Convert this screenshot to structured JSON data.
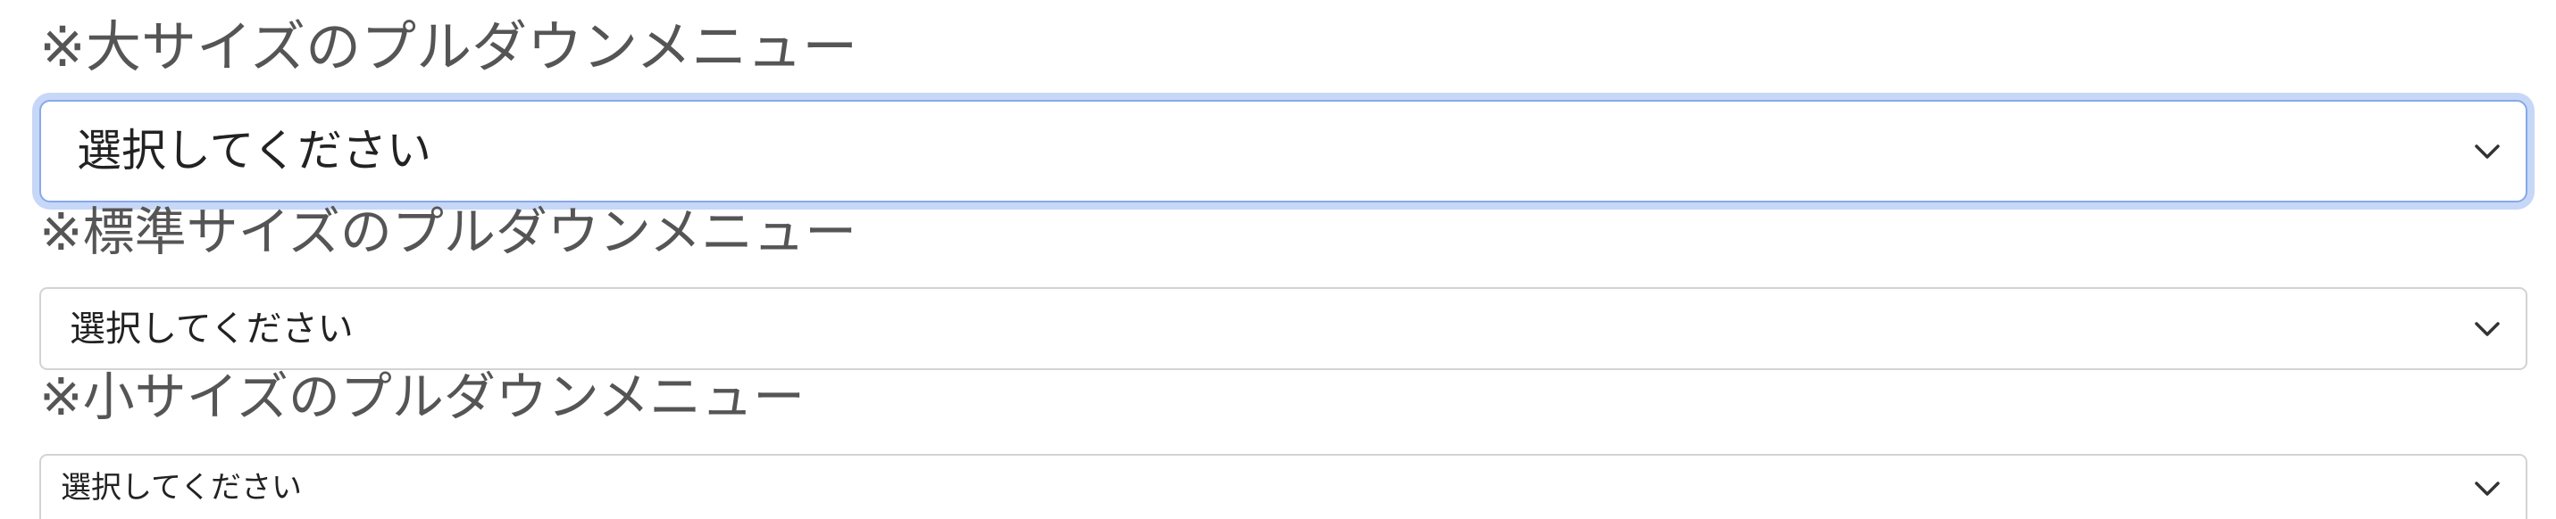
{
  "sections": [
    {
      "heading": "※大サイズのプルダウンメニュー",
      "select_value": "選択してください",
      "size": "large",
      "focused": true
    },
    {
      "heading": "※標準サイズのプルダウンメニュー",
      "select_value": "選択してください",
      "size": "normal",
      "focused": false
    },
    {
      "heading": "※小サイズのプルダウンメニュー",
      "select_value": "選択してください",
      "size": "small",
      "focused": false
    }
  ],
  "icons": {
    "dropdown": "chevron-down-icon"
  },
  "colors": {
    "heading": "#555555",
    "border": "#d3d3d3",
    "focus_ring": "#c7d7f7",
    "focus_border": "#87a9e8",
    "text": "#222222"
  }
}
